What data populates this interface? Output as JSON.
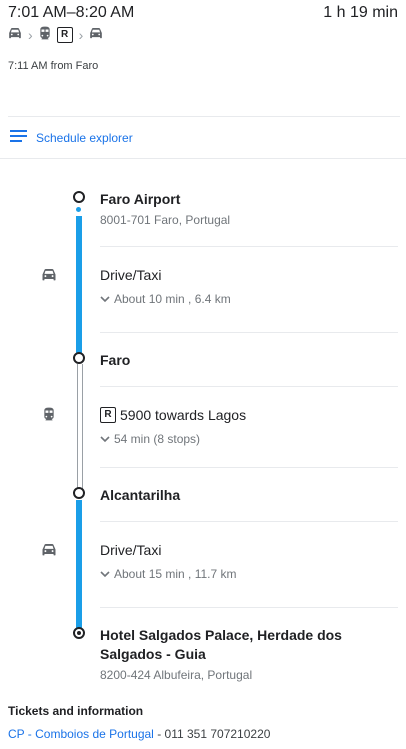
{
  "header": {
    "time_range": "7:01 AM–8:20 AM",
    "duration": "1 h 19 min",
    "modes": [
      "car-icon",
      "train-icon",
      "R",
      "car-icon"
    ],
    "departure": "7:11 AM from Faro"
  },
  "schedule_explorer": {
    "label": "Schedule explorer",
    "icon": "list-icon"
  },
  "itinerary": {
    "stops": [
      {
        "name": "Faro Airport",
        "address": "8001-701 Faro, Portugal"
      },
      {
        "name": "Faro",
        "address": ""
      },
      {
        "name": "Alcantarilha",
        "address": ""
      },
      {
        "name": "Hotel Salgados Palace, Herdade dos Salgados - Guia",
        "address": "8200-424 Albufeira, Portugal"
      }
    ],
    "legs": [
      {
        "mode": "Drive/Taxi",
        "icon": "car-icon",
        "details": "About 10 min , 6.4 km"
      },
      {
        "mode": "5900 towards Lagos",
        "badge": "R",
        "icon": "train-icon",
        "details": "54 min (8 stops)"
      },
      {
        "mode": "Drive/Taxi",
        "icon": "car-icon",
        "details": "About 15 min , 11.7 km"
      }
    ]
  },
  "tickets": {
    "heading": "Tickets and information",
    "provider_link": "CP - Comboios de Portugal",
    "phone": "011 351 707210220",
    "separator": " - "
  },
  "colors": {
    "route_blue": "#1a9ee8",
    "link_blue": "#1a73e8",
    "text": "#202124",
    "muted": "#70757a"
  }
}
